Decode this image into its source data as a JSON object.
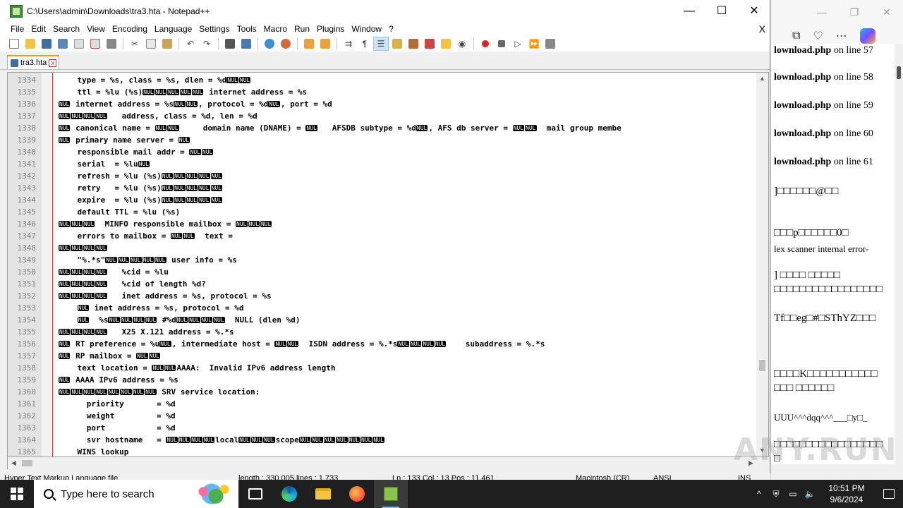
{
  "window": {
    "title": "C:\\Users\\admin\\Downloads\\tra3.hta - Notepad++",
    "min": "—",
    "max": "☐",
    "close": "✕"
  },
  "menu": [
    "File",
    "Edit",
    "Search",
    "View",
    "Encoding",
    "Language",
    "Settings",
    "Tools",
    "Macro",
    "Run",
    "Plugins",
    "Window",
    "?"
  ],
  "menu_close": "X",
  "tab": {
    "label": "tra3.hta",
    "close": "x"
  },
  "lines": [
    {
      "n": "1334",
      "t": "    type = %s, class = %s, dlen = %d{N}{N}"
    },
    {
      "n": "1335",
      "t": "    ttl = %lu (%s){N}{N}{N}{N}{N} internet address = %s"
    },
    {
      "n": "1336",
      "t": "{N} internet address = %s{N}{N}, protocol = %d{N}, port = %d"
    },
    {
      "n": "1337",
      "t": "{N}{N}{N}{N}   address, class = %d, len = %d"
    },
    {
      "n": "1338",
      "t": "{N} canonical name = {N}{N}     domain name (DNAME) = {N}   AFSDB subtype = %d{N}, AFS db server = {N}{N}  mail group membe"
    },
    {
      "n": "1339",
      "t": "{N} primary name server = {N}"
    },
    {
      "n": "1340",
      "t": "    responsible mail addr = {N}{N}"
    },
    {
      "n": "1341",
      "t": "    serial  = %lu{N}"
    },
    {
      "n": "1342",
      "t": "    refresh = %lu (%s){N}{N}{N}{N}{N}"
    },
    {
      "n": "1343",
      "t": "    retry   = %lu (%s){N}{N}{N}{N}{N}"
    },
    {
      "n": "1344",
      "t": "    expire  = %lu (%s){N}{N}{N}{N}{N}"
    },
    {
      "n": "1345",
      "t": "    default TTL = %lu (%s)"
    },
    {
      "n": "1346",
      "t": "{N}{N}{N}  MINFO responsible mailbox = {N}{N}{N}"
    },
    {
      "n": "1347",
      "t": "    errors to mailbox = {N}{N}  text ="
    },
    {
      "n": "1348",
      "t": "{N}{N}{N}{N}"
    },
    {
      "n": "1349",
      "t": "    \"%.*s\"{N}{N}{N}{N}{N} user info = %s"
    },
    {
      "n": "1350",
      "t": "{N}{N}{N}{N}   %cid = %lu"
    },
    {
      "n": "1351",
      "t": "{N}{N}{N}{N}   %cid of length %d?"
    },
    {
      "n": "1352",
      "t": "{N}{N}{N}{N}   inet address = %s, protocol = %s"
    },
    {
      "n": "1353",
      "t": "    {N} inet address = %s, protocol = %d"
    },
    {
      "n": "1354",
      "t": "    {N}  %s{N}{N}{N}{N} #%d{N}{N}{N}{N}  NULL (dlen %d)"
    },
    {
      "n": "1355",
      "t": "{N}{N}{N}{N}   X25 X.121 address = %.*s"
    },
    {
      "n": "1356",
      "t": "{N} RT preference = %u{N}, intermediate host = {N}{N}  ISDN address = %.*s{N}{N}{N}{N}    subaddress = %.*s"
    },
    {
      "n": "1357",
      "t": "{N} RP mailbox = {N}{N}"
    },
    {
      "n": "1358",
      "t": "    text location = {N}{N}AAAA:  Invalid IPv6 address length"
    },
    {
      "n": "1359",
      "t": "{N} AAAA IPv6 address = %s"
    },
    {
      "n": "1360",
      "t": "{N}{N}{N}{N}{N}{N}{N}{N} SRV service location:"
    },
    {
      "n": "1361",
      "t": "      priority       = %d"
    },
    {
      "n": "1362",
      "t": "      weight         = %d"
    },
    {
      "n": "1363",
      "t": "      port           = %d"
    },
    {
      "n": "1364",
      "t": "      svr hostname   = {N}{N}{N}{N}local{N}{N}{N}scope{N}{N}{N}{N}{N}{N}{N}"
    },
    {
      "n": "1365",
      "t": "    WINS lookup"
    }
  ],
  "nul_token": "NUL",
  "status": {
    "type": "Hyper Text Markup Language file",
    "length": "length : 330,005    lines : 1,733",
    "pos": "Ln : 133    Col : 13    Pos : 11,461",
    "eol": "Macintosh (CR)",
    "enc": "ANSI",
    "mode": "INS"
  },
  "bg_browser": {
    "lines": [
      {
        "bold": "lownload.php",
        "rest": " on line 57"
      },
      {
        "bold": "lownload.php",
        "rest": " on line 58"
      },
      {
        "bold": "lownload.php",
        "rest": " on line 59"
      },
      {
        "bold": "lownload.php",
        "rest": " on line 60"
      },
      {
        "bold": "lownload.php",
        "rest": " on line 61"
      }
    ],
    "garble1": "]□□□□□□@□□",
    "garble2": "□□□p□□□□□□0□",
    "scanner": "lex scanner internal error-",
    "garble3": "] □□□□ □□□□□",
    "garble4": "□□□□□□□□□□□□□□□□□",
    "garble5": "Tf□□eg□#□SThYZ□□□",
    "garble6": "□□□□K□□□□□□□□□□□",
    "garble7": "□□□ □□□□□□",
    "garble8": "UUU^^^dqq^^^___□y□_",
    "garble9": "□□□□□□□□□□□□□□□□□",
    "garble10": "□",
    "watermark": "ANY.RUN"
  },
  "taskbar": {
    "search_placeholder": "Type here to search",
    "time": "10:51 PM",
    "date": "9/6/2024"
  }
}
